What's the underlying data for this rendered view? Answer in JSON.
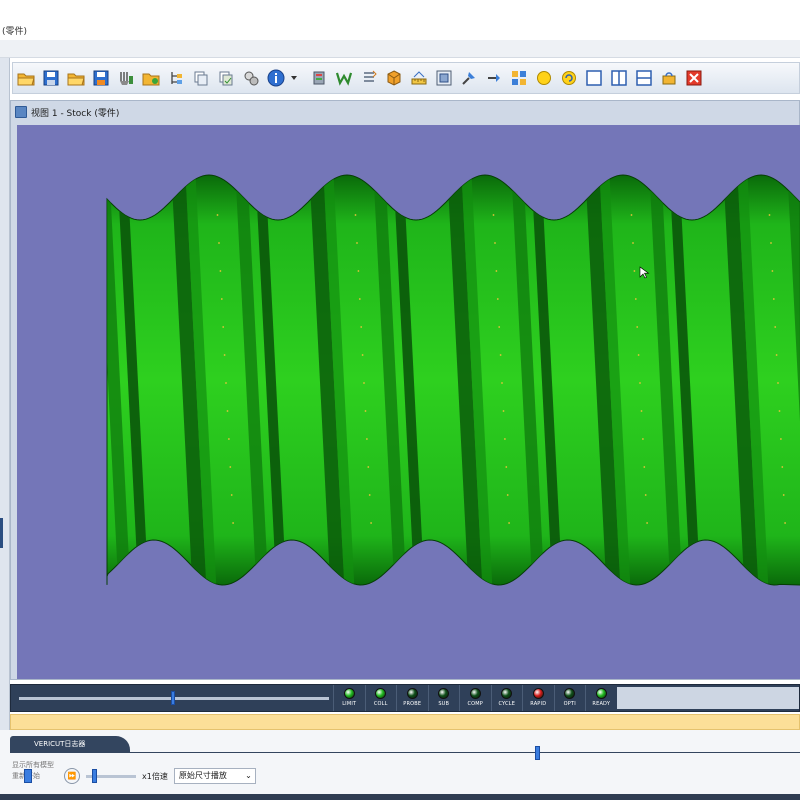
{
  "window": {
    "title": "(零件)"
  },
  "view": {
    "tab_title": "视图 1 - Stock (零件)"
  },
  "toolbar": {
    "icons": [
      "open-folder-icon",
      "save-icon",
      "open-folder-icon",
      "save-icon",
      "wrench-icon",
      "folder-icon",
      "tree-icon",
      "copy-icon",
      "copy-icon",
      "gears-icon",
      "info-icon",
      "dropdown-arrow-icon",
      "stock-icon",
      "w-icon",
      "list-icon",
      "cube-icon",
      "measure-icon",
      "frame-icon",
      "zoom-in-icon",
      "zoom-out-icon",
      "grid-icon",
      "yellow-circle-icon",
      "refresh-icon",
      "single-view-icon",
      "split-vertical-icon",
      "split-horizontal-icon",
      "reset-icon",
      "close-icon"
    ]
  },
  "colors": {
    "canvas_bg": "#7476b8",
    "part_green": "#22c814",
    "led_green": "#1fb81f",
    "led_red": "#d51a1a",
    "led_dark": "#0f4f1a"
  },
  "statusbar": {
    "timeline_progress": 0.49,
    "leds": [
      {
        "label": "LIMIT",
        "state": "on",
        "color": "#1fb81f"
      },
      {
        "label": "COLL",
        "state": "on",
        "color": "#1fb81f"
      },
      {
        "label": "PROBE",
        "state": "off",
        "color": "#0f4f1a"
      },
      {
        "label": "SUB",
        "state": "off",
        "color": "#0f4f1a"
      },
      {
        "label": "COMP",
        "state": "off",
        "color": "#0f4f1a"
      },
      {
        "label": "CYCLE",
        "state": "off",
        "color": "#0f4f1a"
      },
      {
        "label": "RAPID",
        "state": "on",
        "color": "#d51a1a"
      },
      {
        "label": "OPTI",
        "state": "off",
        "color": "#0f4f1a"
      },
      {
        "label": "READY",
        "state": "on",
        "color": "#1fb81f"
      }
    ]
  },
  "bottom": {
    "panel_tab": "VERICUT日志器",
    "check_line_1": "显示所有模型",
    "check_line_2": "重新开始",
    "speed_label": "x1倍速",
    "play_mode": "原始尺寸播放",
    "sim_progress": 0.71,
    "speed_progress": 0.12
  }
}
